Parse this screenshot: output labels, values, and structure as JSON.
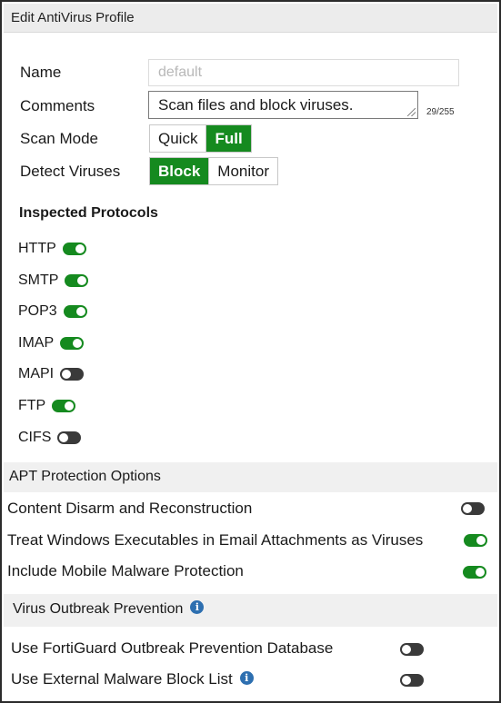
{
  "window": {
    "title": "Edit AntiVirus Profile"
  },
  "form": {
    "name_label": "Name",
    "name_value": "default",
    "comments_label": "Comments",
    "comments_value": "Scan files and block viruses.",
    "comments_counter": "29/255",
    "scan_mode_label": "Scan Mode",
    "scan_mode_options": [
      "Quick",
      "Full"
    ],
    "scan_mode_selected": "Full",
    "detect_label": "Detect Viruses",
    "detect_options": [
      "Block",
      "Monitor"
    ],
    "detect_selected": "Block"
  },
  "protocols": {
    "title": "Inspected Protocols",
    "items": [
      {
        "label": "HTTP",
        "enabled": true
      },
      {
        "label": "SMTP",
        "enabled": true
      },
      {
        "label": "POP3",
        "enabled": true
      },
      {
        "label": "IMAP",
        "enabled": true
      },
      {
        "label": "MAPI",
        "enabled": false
      },
      {
        "label": "FTP",
        "enabled": true
      },
      {
        "label": "CIFS",
        "enabled": false
      }
    ]
  },
  "apt": {
    "title": "APT Protection Options",
    "options": [
      {
        "label": "Content Disarm and Reconstruction",
        "enabled": false
      },
      {
        "label": "Treat Windows Executables in Email Attachments as Viruses",
        "enabled": true
      },
      {
        "label": "Include Mobile Malware Protection",
        "enabled": true
      }
    ]
  },
  "outbreak": {
    "title": "Virus Outbreak Prevention",
    "options": [
      {
        "label": "Use FortiGuard Outbreak Prevention Database",
        "enabled": false,
        "info": false
      },
      {
        "label": "Use External Malware Block List",
        "enabled": false,
        "info": true
      }
    ]
  },
  "colors": {
    "accent": "#158a1f",
    "info": "#2d6fb0",
    "band": "#f0f0f0",
    "toggle_off": "#3a3a3a"
  },
  "icons": {
    "info": "info-icon",
    "resize": "resize-grip-icon"
  }
}
